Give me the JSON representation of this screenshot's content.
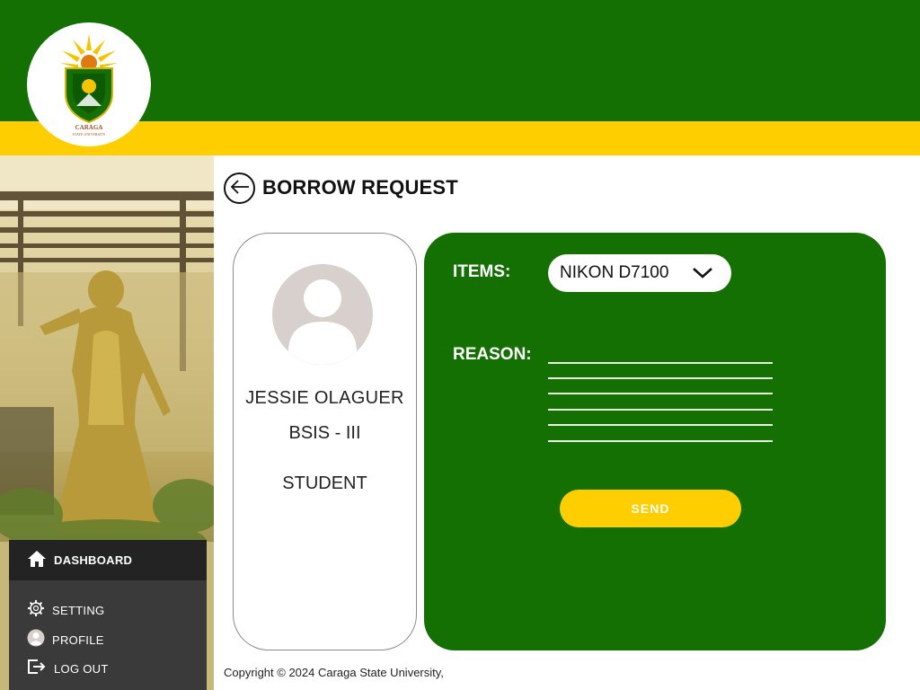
{
  "colors": {
    "brand_green": "#157004",
    "brand_yellow": "#ffce00",
    "nav_dark": "#232323",
    "nav_panel": "#3a3a3a"
  },
  "header": {
    "logo": {
      "name": "caraga-state-university-seal",
      "text": "CARAGA STATE UNIVERSITY PHILIPPINES"
    }
  },
  "sidebar": {
    "photo": "campus-statue-photo",
    "dashboard": {
      "label": "DASHBOARD",
      "icon": "home-icon"
    },
    "items": [
      {
        "label": "SETTING",
        "icon": "gear-icon"
      },
      {
        "label": "PROFILE",
        "icon": "user-icon"
      },
      {
        "label": "LOG OUT",
        "icon": "logout-icon"
      }
    ]
  },
  "page": {
    "title": "BORROW REQUEST",
    "back_icon": "arrow-left-icon"
  },
  "profile": {
    "name": "JESSIE OLAGUER",
    "course": "BSIS - III",
    "role": "STUDENT"
  },
  "form": {
    "items_label": "ITEMS:",
    "items_value": "NIKON D7100",
    "reason_label": "REASON:",
    "reason_value": "",
    "send_label": "SEND"
  },
  "footer": {
    "copyright": "Copyright © 2024  Caraga State University,"
  }
}
